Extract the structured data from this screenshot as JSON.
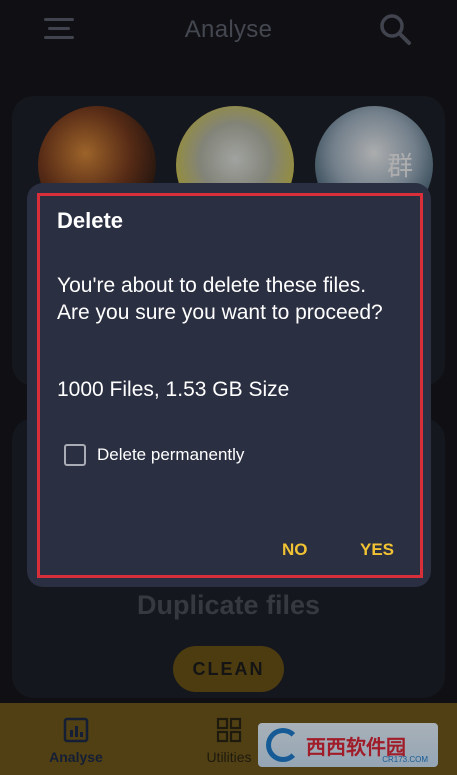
{
  "header": {
    "title": "Analyse",
    "menu_icon": "hamburger-menu-icon",
    "search_icon": "search-icon"
  },
  "section": {
    "title": "Duplicate files",
    "clean_label": "CLEAN"
  },
  "dialog": {
    "title": "Delete",
    "message": "You're about to delete these files. Are you sure you want to proceed?",
    "summary": "1000 Files, 1.53 GB Size",
    "checkbox_label": "Delete permanently",
    "checkbox_checked": false,
    "no_label": "NO",
    "yes_label": "YES"
  },
  "bottom_nav": {
    "items": [
      {
        "label": "Analyse",
        "icon": "bar-chart-icon",
        "active": true
      },
      {
        "label": "Utilities",
        "icon": "grid-icon",
        "active": false
      }
    ]
  },
  "watermark": {
    "text": "西西软件园",
    "sub": "CR173.COM"
  },
  "colors": {
    "accent": "#f1c232",
    "dialog_bg": "#2b2f42",
    "highlight": "#d82f3a",
    "nav_bg": "#70591c"
  }
}
